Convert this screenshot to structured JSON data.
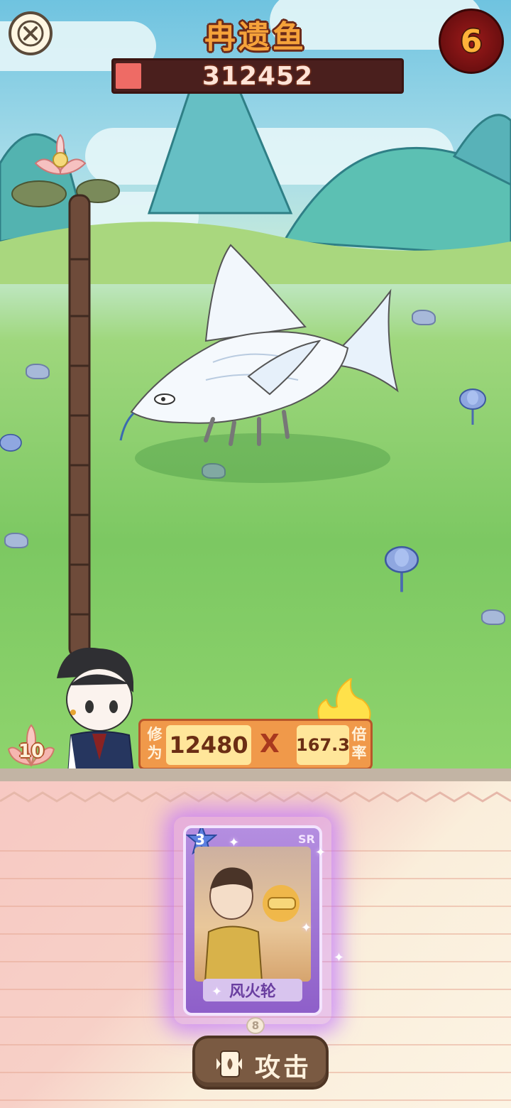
{
  "boss": {
    "name": "冉遗鱼",
    "hp_value": "312452",
    "hp_fraction": 0.09
  },
  "turns_remaining": "6",
  "player": {
    "lotus_count": "10",
    "cultivation_label_1": "修",
    "cultivation_label_2": "为",
    "cultivation_value": "12480",
    "multiply_symbol": "X",
    "multiplier_value": "167.3",
    "multiplier_label_1": "倍",
    "multiplier_label_2": "率"
  },
  "card": {
    "star_level": "3",
    "rarity": "SR",
    "name": "风火轮",
    "cost": "8"
  },
  "attack_button": {
    "label": "攻击"
  },
  "colors": {
    "title_orange": "#f5a23a",
    "hp_fill": "#ee6b65",
    "hp_bar_bg": "#4a1f1d",
    "turn_badge": "#9c1a1a",
    "power_panel": "#f0994a",
    "card_glow": "#be6eff",
    "attack_button": "#7a5a42"
  },
  "icons": [
    "close-icon",
    "lotus-icon",
    "card-icon",
    "flame-icon"
  ]
}
